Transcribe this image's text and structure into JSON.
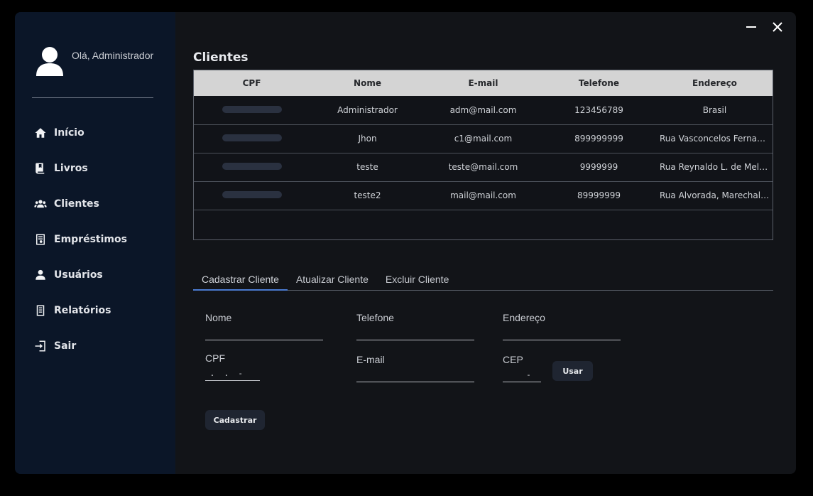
{
  "sidebar": {
    "greeting": "Olá, Administrador",
    "items": [
      {
        "label": "Início",
        "icon": "home-icon"
      },
      {
        "label": "Livros",
        "icon": "book-icon"
      },
      {
        "label": "Clientes",
        "icon": "users-icon"
      },
      {
        "label": "Empréstimos",
        "icon": "loan-icon"
      },
      {
        "label": "Usuários",
        "icon": "user-icon"
      },
      {
        "label": "Relatórios",
        "icon": "report-icon"
      },
      {
        "label": "Sair",
        "icon": "logout-icon"
      }
    ]
  },
  "main": {
    "title": "Clientes",
    "table": {
      "columns": [
        "CPF",
        "Nome",
        "E-mail",
        "Telefone",
        "Endereço"
      ],
      "rows": [
        {
          "cpf": "",
          "nome": "Administrador",
          "email": "adm@mail.com",
          "telefone": "123456789",
          "endereco": "Brasil"
        },
        {
          "cpf": "",
          "nome": "Jhon",
          "email": "c1@mail.com",
          "telefone": "899999999",
          "endereco": "Rua Vasconcelos Fernandes,..."
        },
        {
          "cpf": "",
          "nome": "teste",
          "email": "teste@mail.com",
          "telefone": "9999999",
          "endereco": "Rua Reynaldo L. de Mello, F..."
        },
        {
          "cpf": "",
          "nome": "teste2",
          "email": "mail@mail.com",
          "telefone": "89999999",
          "endereco": "Rua Alvorada, Marechal Ro..."
        }
      ]
    },
    "tabs": [
      {
        "label": "Cadastrar Cliente",
        "active": true
      },
      {
        "label": "Atualizar Cliente",
        "active": false
      },
      {
        "label": "Excluir Cliente",
        "active": false
      }
    ],
    "form": {
      "nome_label": "Nome",
      "nome_value": "",
      "telefone_label": "Telefone",
      "telefone_value": "",
      "endereco_label": "Endereço",
      "endereco_value": "",
      "cpf_label": "CPF",
      "cpf_value": " .  .  -",
      "email_label": "E-mail",
      "email_value": "",
      "cep_label": "CEP",
      "cep_value": "     -",
      "usar_label": "Usar",
      "cadastrar_label": "Cadastrar"
    }
  },
  "colors": {
    "window_bg": "#121418",
    "sidebar_bg": "#0b1628",
    "table_header_bg": "#d4d4d4",
    "tab_accent": "#4b7bd1"
  }
}
